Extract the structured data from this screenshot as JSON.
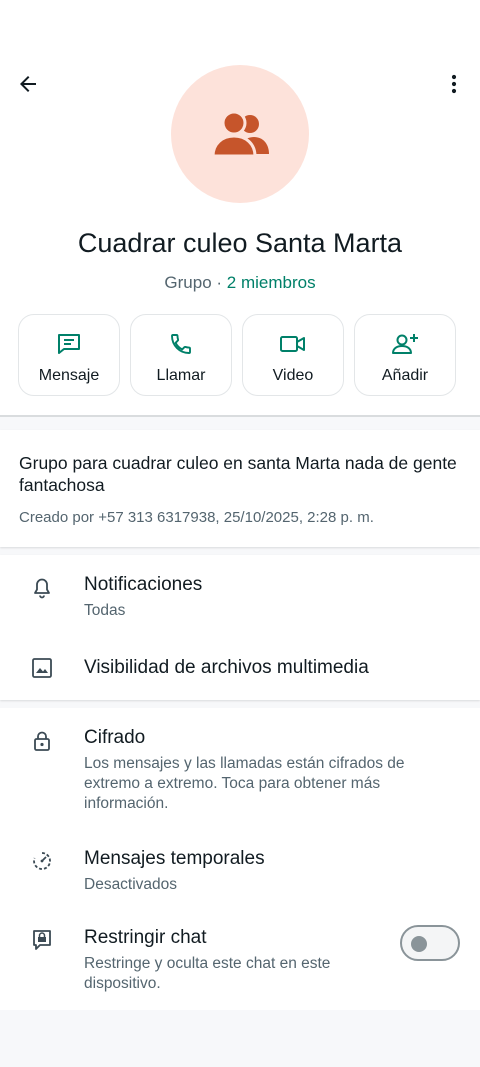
{
  "header": {
    "group_name": "Cuadrar culeo Santa Marta",
    "subtitle_type": "Grupo",
    "subtitle_separator": " · ",
    "subtitle_members": "2 miembros"
  },
  "actions": [
    {
      "label": "Mensaje",
      "icon": "message-icon"
    },
    {
      "label": "Llamar",
      "icon": "phone-icon"
    },
    {
      "label": "Video",
      "icon": "video-icon"
    },
    {
      "label": "Añadir",
      "icon": "add-person-icon"
    }
  ],
  "description": {
    "text": "Grupo para cuadrar culeo en santa Marta nada de gente fantachosa",
    "created": "Creado por +57 313 6317938, 25/10/2025, 2:28 p. m."
  },
  "settings": {
    "notifications": {
      "title": "Notificaciones",
      "value": "Todas"
    },
    "media_visibility": {
      "title": "Visibilidad de archivos multimedia"
    },
    "encryption": {
      "title": "Cifrado",
      "description": "Los mensajes y las llamadas están cifrados de extremo a extremo. Toca para obtener más información."
    },
    "temporary_messages": {
      "title": "Mensajes temporales",
      "value": "Desactivados"
    },
    "restrict_chat": {
      "title": "Restringir chat",
      "description": "Restringe y oculta este chat en este dispositivo.",
      "enabled": false
    }
  },
  "colors": {
    "accent": "#008069",
    "avatar_bg": "#fde2da",
    "avatar_icon": "#c6552b"
  }
}
